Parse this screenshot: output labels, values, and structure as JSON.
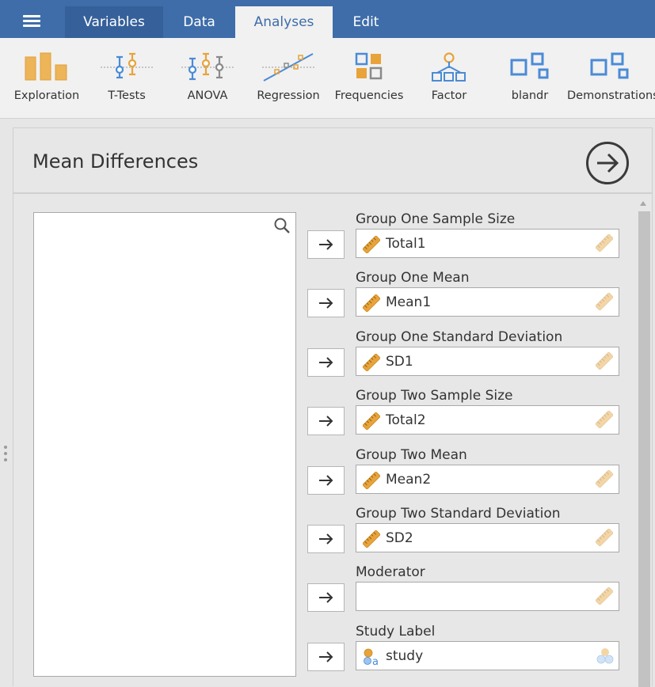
{
  "topbar": {
    "tabs": [
      {
        "label": "Variables"
      },
      {
        "label": "Data"
      },
      {
        "label": "Analyses"
      },
      {
        "label": "Edit"
      }
    ],
    "active_tab": "Analyses"
  },
  "ribbon": {
    "buttons": [
      {
        "label": "Exploration",
        "icon": "exploration-icon"
      },
      {
        "label": "T-Tests",
        "icon": "t-tests-icon"
      },
      {
        "label": "ANOVA",
        "icon": "anova-icon"
      },
      {
        "label": "Regression",
        "icon": "regression-icon"
      },
      {
        "label": "Frequencies",
        "icon": "frequencies-icon"
      },
      {
        "label": "Factor",
        "icon": "factor-icon"
      },
      {
        "label": "blandr",
        "icon": "module-icon"
      },
      {
        "label": "Demonstrations",
        "icon": "module-icon"
      }
    ]
  },
  "panel": {
    "title": "Mean Differences",
    "fields": [
      {
        "label": "Group One Sample Size",
        "value": "Total1",
        "var_type": "continuous"
      },
      {
        "label": "Group One Mean",
        "value": "Mean1",
        "var_type": "continuous"
      },
      {
        "label": "Group One Standard Deviation",
        "value": "SD1",
        "var_type": "continuous"
      },
      {
        "label": "Group Two Sample Size",
        "value": "Total2",
        "var_type": "continuous"
      },
      {
        "label": "Group Two Mean",
        "value": "Mean2",
        "var_type": "continuous"
      },
      {
        "label": "Group Two Standard Deviation",
        "value": "SD2",
        "var_type": "continuous"
      },
      {
        "label": "Moderator",
        "value": "",
        "var_type": "continuous"
      },
      {
        "label": "Study Label",
        "value": "study",
        "var_type": "nominal-text"
      }
    ]
  },
  "colors": {
    "header_blue": "#3e6da9",
    "ruler_orange": "#e8a33a",
    "icon_blue": "#4a8bd6"
  }
}
